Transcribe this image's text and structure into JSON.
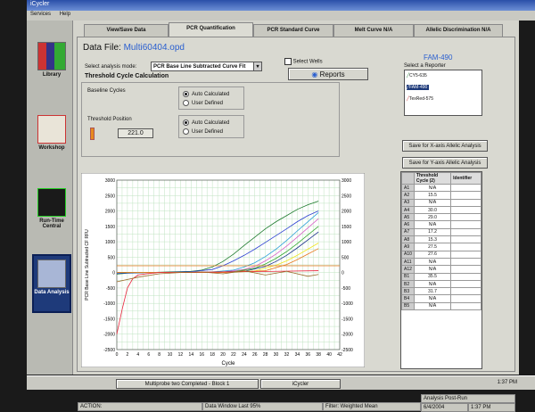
{
  "window": {
    "title": "iCycler"
  },
  "menu": [
    "Services",
    "Help"
  ],
  "sidebar": [
    {
      "label": "Library",
      "icon": "library-icon"
    },
    {
      "label": "Workshop",
      "icon": "workshop-icon"
    },
    {
      "label": "Run-Time Central",
      "icon": "runtime-icon"
    },
    {
      "label": "Data Analysis",
      "icon": "analysis-icon",
      "active": true
    }
  ],
  "tabs": [
    "View/Save Data",
    "PCR Quantification",
    "PCR Standard Curve",
    "Melt Curve N/A",
    "Allelic Discrimination N/A"
  ],
  "data_file": {
    "label": "Data File:",
    "name": "Multi60404.opd"
  },
  "analysis_mode": {
    "label": "Select analysis mode:",
    "value": "PCR Base Line Subtracted Curve Fit"
  },
  "select_wells": "Select Wells",
  "reports": "Reports",
  "threshold_title": "Threshold Cycle Calculation",
  "baseline": {
    "label": "Baseline Cycles",
    "opt1": "Auto Calculated",
    "opt2": "User Defined"
  },
  "threshold": {
    "label": "Threshold Position",
    "value": "221.0",
    "opt1": "Auto Calculated",
    "opt2": "User Defined"
  },
  "reporter": {
    "title": "FAM-490",
    "label": "Select a Reporter",
    "items": [
      "CY5-635",
      "FAM-490",
      "TexRed-575"
    ]
  },
  "allelic_x": "Save for X-axis Allelic Analysis",
  "allelic_y": "Save for Y-axis Allelic Analysis",
  "table": {
    "headers": [
      "",
      "Threshold Cycle (2)",
      "Identifier"
    ],
    "rows": [
      [
        "A1",
        "N/A"
      ],
      [
        "A2",
        "15.5"
      ],
      [
        "A3",
        "N/A"
      ],
      [
        "A4",
        "30.0"
      ],
      [
        "A5",
        "29.0"
      ],
      [
        "A6",
        "N/A"
      ],
      [
        "A7",
        "17.2"
      ],
      [
        "A8",
        "15.3"
      ],
      [
        "A9",
        "27.5"
      ],
      [
        "A10",
        "27.6"
      ],
      [
        "A11",
        "N/A"
      ],
      [
        "A12",
        "N/A"
      ],
      [
        "B1",
        "35.5"
      ],
      [
        "B2",
        "N/A"
      ],
      [
        "B3",
        "31.7"
      ],
      [
        "B4",
        "N/A"
      ],
      [
        "B5",
        "N/A"
      ]
    ]
  },
  "wells": [
    {
      "label": "A1",
      "color": "#e8231e"
    },
    {
      "label": "A2",
      "color": "#36a832"
    },
    {
      "label": "A3",
      "color": "#1c7a2c"
    },
    {
      "label": "A4",
      "color": "#2a9fd8"
    },
    {
      "label": "A5",
      "color": "#2a3fd0"
    },
    {
      "label": "A6",
      "color": "#d860c8"
    },
    {
      "label": "A7",
      "color": "#9a6a2a"
    },
    {
      "label": "A8",
      "color": "#e8233a"
    },
    {
      "label": "A9",
      "color": "#1a2f8a"
    },
    {
      "label": "A10",
      "color": "#f0e61e"
    },
    {
      "label": "A11",
      "color": "#e8791e"
    },
    {
      "label": "A12",
      "color": "#d01e1e"
    },
    {
      "label": "B1",
      "color": "#1c8a2c"
    }
  ],
  "status": {
    "action": "ACTION:",
    "window": "Data Window Last 95%",
    "filter": "Filter: Weighted Mean",
    "analysis": "Analysis Post-Run",
    "date": "6/4/2004",
    "time": "1:37 PM"
  },
  "taskbar": {
    "item1": "Multiprobe two Completed - Block 1",
    "item2": "iCycler",
    "clock": "1:37 PM"
  },
  "chart_data": {
    "type": "line",
    "ylabel": "PCR Base Line Subtracted CF RFU",
    "xlabel": "Cycle",
    "xlim": [
      0,
      42
    ],
    "ylim": [
      -2500,
      3000
    ],
    "xticks": [
      0,
      2,
      4,
      6,
      8,
      10,
      12,
      14,
      16,
      18,
      20,
      22,
      24,
      26,
      28,
      30,
      32,
      34,
      36,
      38,
      40,
      42
    ],
    "yticks": [
      3000,
      2500,
      2000,
      1500,
      1000,
      500,
      0,
      -500,
      -1000,
      -1500,
      -2000,
      -2500
    ],
    "threshold": 221,
    "grid": true,
    "series": [
      {
        "color": "#1c7a2c",
        "x": [
          0,
          2,
          6,
          10,
          14,
          16,
          18,
          20,
          22,
          24,
          26,
          28,
          30,
          32,
          34,
          36,
          38
        ],
        "y": [
          -50,
          -20,
          0,
          20,
          40,
          80,
          180,
          360,
          600,
          880,
          1150,
          1420,
          1650,
          1850,
          2050,
          2200,
          2320
        ]
      },
      {
        "color": "#2a3fd0",
        "x": [
          0,
          6,
          10,
          14,
          18,
          20,
          22,
          24,
          26,
          28,
          30,
          32,
          34,
          36,
          38
        ],
        "y": [
          -20,
          0,
          10,
          30,
          100,
          220,
          380,
          560,
          760,
          980,
          1200,
          1420,
          1650,
          1850,
          2000
        ]
      },
      {
        "color": "#2a9fd8",
        "x": [
          0,
          10,
          18,
          22,
          24,
          26,
          28,
          30,
          32,
          34,
          36,
          38
        ],
        "y": [
          0,
          0,
          20,
          80,
          180,
          320,
          520,
          760,
          1040,
          1350,
          1650,
          1950
        ]
      },
      {
        "color": "#d860c8",
        "x": [
          0,
          10,
          20,
          24,
          26,
          28,
          30,
          32,
          34,
          36,
          38
        ],
        "y": [
          0,
          0,
          20,
          100,
          200,
          380,
          600,
          860,
          1150,
          1450,
          1750
        ]
      },
      {
        "color": "#36a832",
        "x": [
          0,
          14,
          22,
          26,
          28,
          30,
          32,
          34,
          36,
          38
        ],
        "y": [
          0,
          0,
          30,
          140,
          280,
          460,
          680,
          940,
          1220,
          1500
        ]
      },
      {
        "color": "#1a2f8a",
        "x": [
          0,
          16,
          24,
          28,
          30,
          32,
          34,
          36,
          38
        ],
        "y": [
          0,
          0,
          40,
          200,
          360,
          560,
          800,
          1060,
          1320
        ]
      },
      {
        "color": "#f0e61e",
        "x": [
          0,
          18,
          26,
          30,
          32,
          34,
          36,
          38
        ],
        "y": [
          0,
          0,
          50,
          240,
          380,
          560,
          760,
          960
        ]
      },
      {
        "color": "#e8791e",
        "x": [
          0,
          20,
          28,
          32,
          34,
          36,
          38
        ],
        "y": [
          0,
          0,
          60,
          260,
          420,
          600,
          780
        ]
      },
      {
        "color": "#e8233a",
        "x": [
          0,
          1,
          2,
          3,
          4,
          6,
          8,
          12,
          20,
          30,
          38
        ],
        "y": [
          -2000,
          -1200,
          -500,
          -200,
          -80,
          -30,
          0,
          0,
          20,
          40,
          60
        ]
      },
      {
        "color": "#9a6a2a",
        "x": [
          0,
          4,
          8,
          12,
          16,
          20,
          24,
          28,
          32,
          36,
          38
        ],
        "y": [
          -300,
          -150,
          -40,
          0,
          20,
          -40,
          60,
          -80,
          40,
          -120,
          -60
        ]
      }
    ]
  }
}
